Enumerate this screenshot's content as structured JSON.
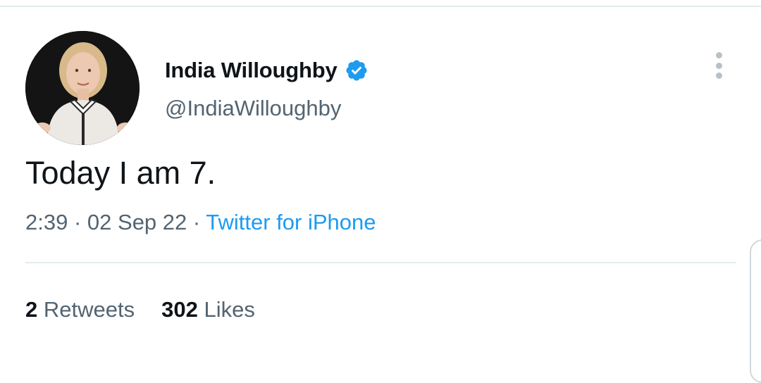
{
  "tweet": {
    "author": {
      "display_name": "India Willoughby",
      "handle": "@IndiaWilloughby",
      "verified": true
    },
    "text": "Today I am 7.",
    "time": "2:39",
    "date": "02 Sep 22",
    "separator": "·",
    "source": "Twitter for iPhone",
    "retweets": {
      "count": "2",
      "label": "Retweets"
    },
    "likes": {
      "count": "302",
      "label": "Likes"
    }
  },
  "colors": {
    "text_primary": "#0f1419",
    "text_secondary": "#536471",
    "accent": "#1d9bf0",
    "divider": "#e4ebee"
  },
  "icons": {
    "verified": "verified-badge-icon",
    "more": "more-vertical-icon"
  }
}
